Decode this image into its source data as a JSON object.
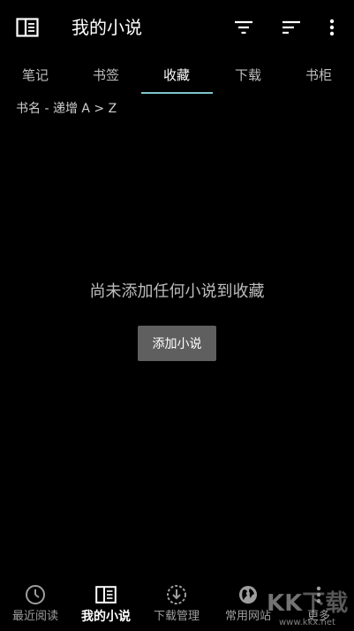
{
  "appbar": {
    "title": "我的小说",
    "icons": [
      "book-icon",
      "filter-icon",
      "sort-icon",
      "more-vert-icon"
    ]
  },
  "tabs": [
    {
      "label": "笔记",
      "active": false
    },
    {
      "label": "书签",
      "active": false
    },
    {
      "label": "收藏",
      "active": true
    },
    {
      "label": "下载",
      "active": false
    },
    {
      "label": "书柜",
      "active": false
    }
  ],
  "sort": {
    "label": "书名 - 递增 A > Z"
  },
  "empty_state": {
    "message": "尚未添加任何小说到收藏",
    "button_label": "添加小说"
  },
  "bottom_nav": [
    {
      "label": "最近阅读",
      "icon": "clock-icon",
      "active": false
    },
    {
      "label": "我的小说",
      "icon": "book-icon",
      "active": true
    },
    {
      "label": "下载管理",
      "icon": "download-icon",
      "active": false
    },
    {
      "label": "常用网站",
      "icon": "globe-icon",
      "active": false
    },
    {
      "label": "更多",
      "icon": "more-vert-icon",
      "active": false
    }
  ],
  "watermark": {
    "text": "KK下载",
    "url": "www.kkx.net"
  },
  "colors": {
    "background": "#000000",
    "tab_indicator": "#7fc6c9",
    "button_bg": "#5f5f5f",
    "inactive_text": "#9e9e9e"
  }
}
